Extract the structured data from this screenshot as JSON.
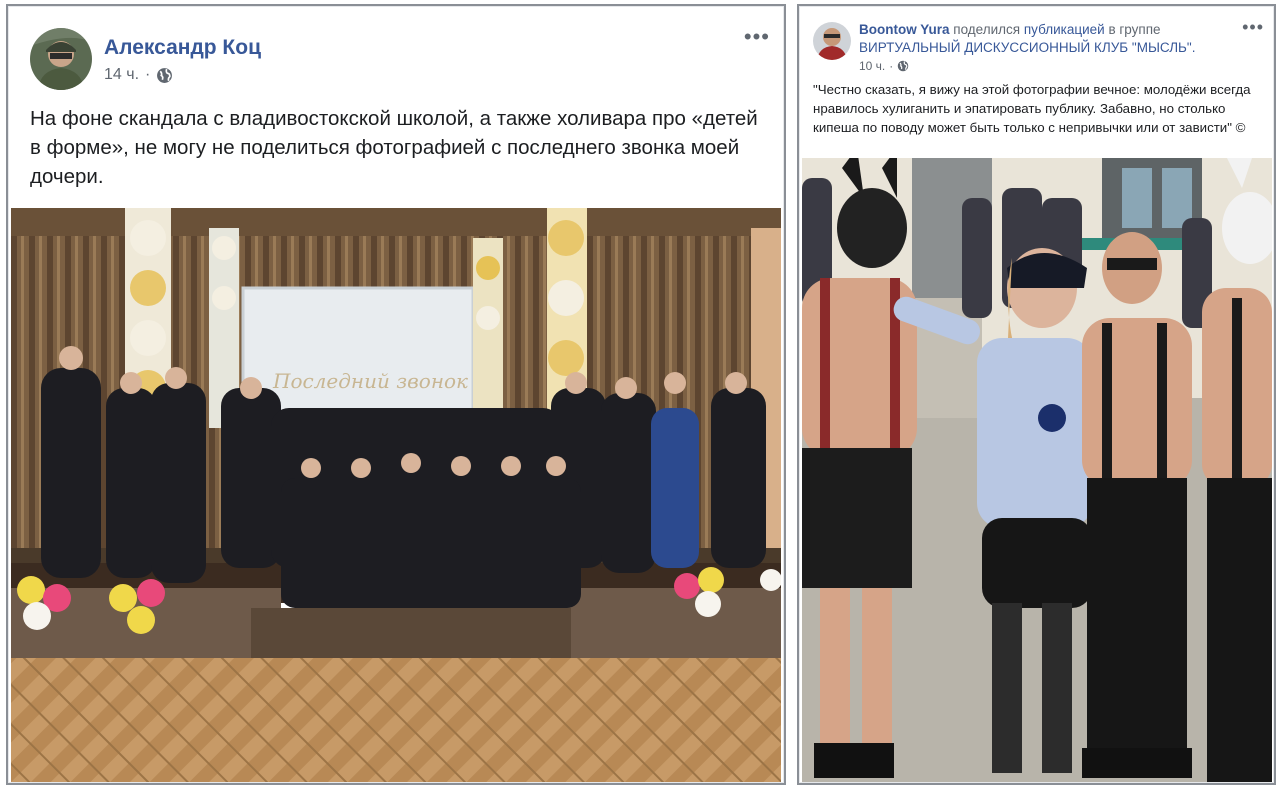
{
  "left_post": {
    "author": "Александр Коц",
    "time": "14 ч.",
    "separator": "·",
    "more_icon": "ellipsis-icon",
    "privacy_icon": "globe-icon",
    "text": "На фоне скандала с владивостокской школой, а также холивара про «детей в форме», не могу не поделиться фотографией с последнего звонка моей дочери.",
    "photo_screen_caption": "Последний звонок"
  },
  "right_post": {
    "author": "Boontow Yura",
    "shared_word": "поделился",
    "shared_link": "публикацией",
    "in_group": "в группе",
    "group_name": "ВИРТУАЛЬНЫЙ ДИСКУССИОННЫЙ КЛУБ \"МЫСЛЬ\".",
    "time": "10 ч.",
    "separator": "·",
    "more_icon": "ellipsis-icon",
    "privacy_icon": "globe-icon",
    "text": "\"Честно сказать, я вижу на этой фотографии вечное: молодёжи всегда нравилось хулиганить и эпатировать публику. Забавно, но столько кипеша по поводу может быть только с непривычки или от зависти\" ©"
  },
  "colors": {
    "link": "#385898",
    "text": "#1c1e21",
    "muted": "#606770",
    "border": "#8a8f96"
  }
}
